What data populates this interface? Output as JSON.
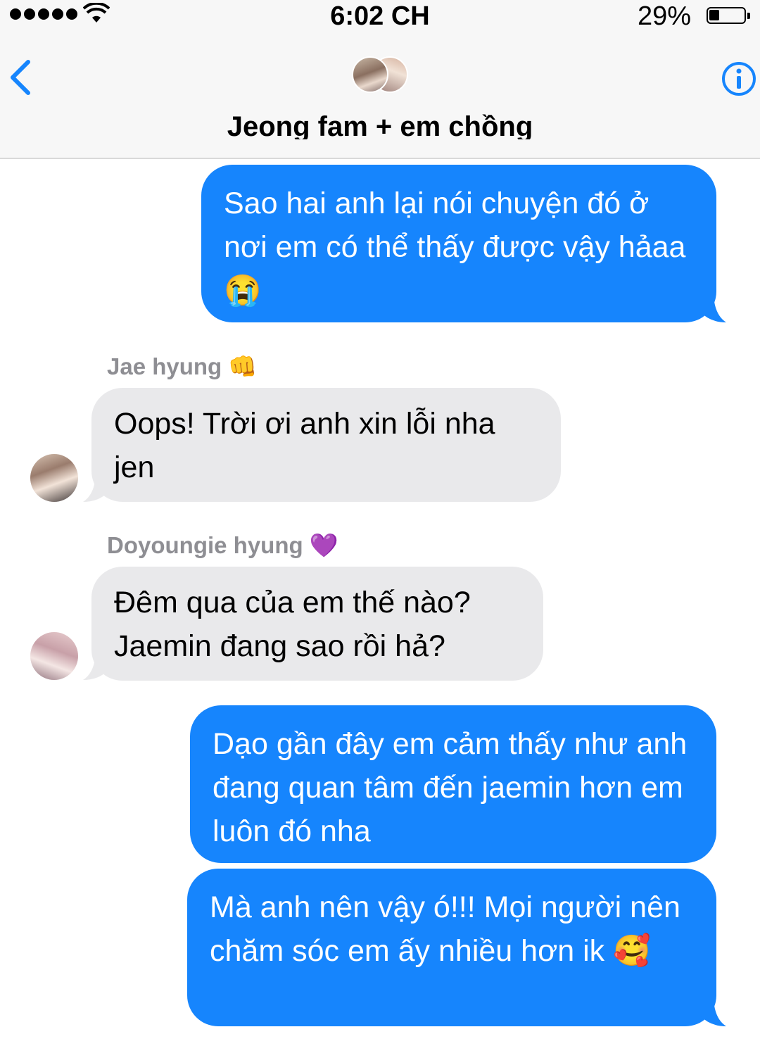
{
  "status_bar": {
    "time": "6:02 CH",
    "battery_percent": "29%",
    "battery_level": 0.29
  },
  "header": {
    "title": "Jeong fam + em chồng"
  },
  "messages": [
    {
      "direction": "outgoing",
      "text": "Sao hai anh lại nói chuyện đó ở nơi em có thể thấy được vậy hảaa 😭"
    },
    {
      "direction": "incoming",
      "sender": "Jae hyung 👊",
      "text": "Oops! Trời ơi anh xin lỗi nha jen"
    },
    {
      "direction": "incoming",
      "sender": "Doyoungie hyung 💜",
      "text": "Đêm qua của em thế nào? Jaemin đang sao rồi hả?"
    },
    {
      "direction": "outgoing",
      "text": "Dạo gần đây em cảm thấy như anh đang quan tâm đến jaemin hơn em luôn đó nha"
    },
    {
      "direction": "outgoing",
      "text": "Mà anh nên vậy ó!!! Mọi người nên chăm sóc em ấy nhiều hơn ik 🥰"
    }
  ],
  "colors": {
    "outgoing": "#1685fd",
    "incoming": "#e9e9eb",
    "accent": "#1685fd"
  },
  "icons": [
    "signal-dots-icon",
    "wifi-icon",
    "battery-icon",
    "back-chevron-icon",
    "info-icon"
  ]
}
